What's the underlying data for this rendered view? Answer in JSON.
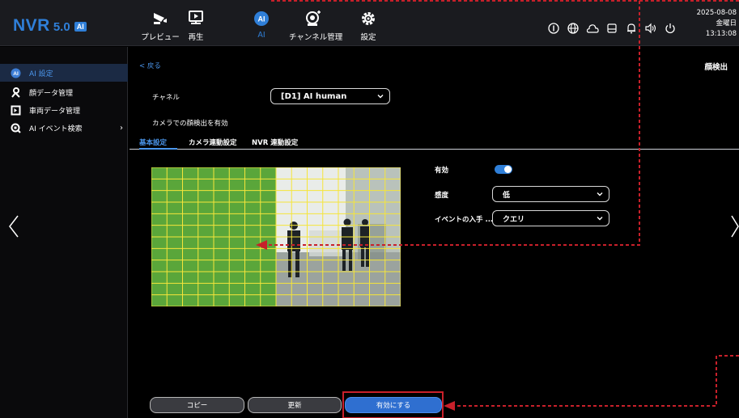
{
  "app": {
    "name": "NVR",
    "version": "5.0",
    "badge": "AI"
  },
  "nav": [
    {
      "id": "preview",
      "label": "プレビュー",
      "icon": "camera-icon"
    },
    {
      "id": "playback",
      "label": "再生",
      "icon": "playback-icon"
    },
    {
      "id": "ai",
      "label": "AI",
      "icon": "ai-icon",
      "active": true
    },
    {
      "id": "channel",
      "label": "チャンネル管理",
      "icon": "channel-camera-icon"
    },
    {
      "id": "settings",
      "label": "設定",
      "icon": "gear-icon"
    }
  ],
  "system_icons": [
    "info-icon",
    "globe-icon",
    "cloud-icon",
    "storage-icon",
    "bell-icon",
    "speaker-icon",
    "power-icon"
  ],
  "clock": {
    "date": "2025-08-08",
    "weekday": "金曜日",
    "time": "13:13:08"
  },
  "sidebar": {
    "items": [
      {
        "label": "AI 設定",
        "icon": "ai-settings-icon",
        "active": true
      },
      {
        "label": "顔データ管理",
        "icon": "face-data-icon"
      },
      {
        "label": "車両データ管理",
        "icon": "vehicle-data-icon"
      },
      {
        "label": "AI イベント検索",
        "icon": "ai-search-icon",
        "has_submenu": true
      }
    ]
  },
  "page": {
    "back_label": "< 戻る",
    "title": "顔検出",
    "channel_label": "チャネル",
    "channel_value": "[D1] AI human",
    "enable_camera_label": "カメラでの顔検出を有効",
    "tabs": [
      "基本設定",
      "カメラ連動設定",
      "NVR 連動設定"
    ],
    "active_tab": 0
  },
  "form": {
    "enable_label": "有効",
    "enable_value": true,
    "sensitivity_label": "感度",
    "sensitivity_value": "低",
    "event_source_label": "イベントの入手 ...",
    "event_source_value": "クエリ"
  },
  "detection_grid": {
    "columns": 16,
    "rows": 12,
    "active_columns": 8
  },
  "buttons": {
    "copy": "コピー",
    "refresh": "更新",
    "enable": "有効にする"
  },
  "colors": {
    "accent": "#2f7fd8",
    "grid_fill": "#5aa63a",
    "grid_line": "#f5e53a",
    "annotation": "#c8202a"
  }
}
